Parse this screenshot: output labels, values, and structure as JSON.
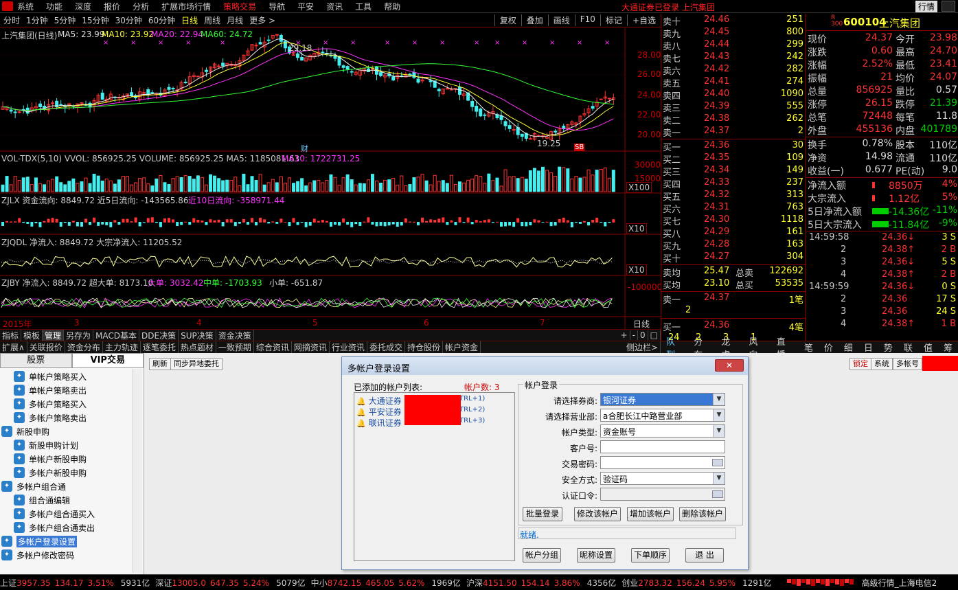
{
  "menu": {
    "items": [
      "系统",
      "功能",
      "深度",
      "报价",
      "分析",
      "扩展市场行情",
      "策略交易",
      "导航",
      "平安",
      "资讯",
      "工具",
      "帮助"
    ],
    "status": "大通证券已登录  上汽集团",
    "quote_btn": "行情"
  },
  "period": {
    "items": [
      "分时",
      "1分钟",
      "5分钟",
      "15分钟",
      "30分钟",
      "60分钟",
      "日线",
      "周线",
      "月线",
      "更多 >"
    ],
    "active": "日线",
    "tools": [
      "复权",
      "叠加",
      "画线",
      "F10",
      "标记",
      "+自选"
    ]
  },
  "chart": {
    "title": "上汽集团(日线)",
    "ma_labels": {
      "ma5": "MA5: 23.99",
      "ma10": "MA10: 23.92",
      "ma20": "MA20: 22.94",
      "ma60": "MA60: 24.72"
    },
    "price_ticks": [
      "28.00",
      "26.00",
      "24.00",
      "22.00",
      "20.00"
    ],
    "high_label": "29.18",
    "low_label": "19.25",
    "vol_label": "VOL-TDX(5,10)  VVOL: 856925.25  VOLUME: 856925.25  MA5: 1185081.63",
    "vol_ma10": "MA10: 1722731.25",
    "vol_ticks": [
      "30000",
      "15000",
      "X100"
    ],
    "zjlx_label": "ZJLX  资金流向: 8849.72   近5日流向: -143565.86",
    "zjlx_10": "近10日流向: -358971.44",
    "zjqdl_label": "ZJQDL  净流入: 8849.72  大宗净流入: 11205.52",
    "zjby_label": "ZJBY  净流入: 8849.72  超大单: 8173.10",
    "zjby_big": "大单: 3032.42",
    "zjby_mid": "中单: -1703.93",
    "zjby_small": "小单: -651.87",
    "x10": "X10",
    "zjby_tick": "-100000",
    "xaxis": [
      "2015年",
      "3",
      "4",
      "5",
      "6",
      "7"
    ],
    "xaxis_right": "日线",
    "cai": "财",
    "sb": "SB"
  },
  "tabs1": [
    "指标",
    "模板",
    "管理",
    "另存为",
    "MACD基本",
    "DDE决策",
    "SUP决策",
    "资金决策"
  ],
  "tabs1_active": "管理",
  "tabs1_right": [
    "+",
    "-",
    "0",
    "□"
  ],
  "tabs2": [
    "扩展∧",
    "关联报价",
    "资金分布",
    "主力轨迹",
    "逐笔委托",
    "热点题材",
    "一致预期",
    "综合资讯",
    "网摘资讯",
    "行业资讯",
    "委托成交",
    "持仓股份",
    "帐户资金"
  ],
  "tabs2_right": "侧边栏>",
  "orderbook": {
    "sells": [
      {
        "l": "卖十",
        "p": "24.46",
        "v": "251"
      },
      {
        "l": "卖九",
        "p": "24.45",
        "v": "800"
      },
      {
        "l": "卖八",
        "p": "24.44",
        "v": "299"
      },
      {
        "l": "卖七",
        "p": "24.43",
        "v": "242"
      },
      {
        "l": "卖六",
        "p": "24.42",
        "v": "282"
      },
      {
        "l": "卖五",
        "p": "24.41",
        "v": "274"
      },
      {
        "l": "卖四",
        "p": "24.40",
        "v": "1090"
      },
      {
        "l": "卖三",
        "p": "24.39",
        "v": "555"
      },
      {
        "l": "卖二",
        "p": "24.38",
        "v": "262"
      },
      {
        "l": "卖一",
        "p": "24.37",
        "v": "2"
      }
    ],
    "buys": [
      {
        "l": "买一",
        "p": "24.36",
        "v": "30"
      },
      {
        "l": "买二",
        "p": "24.35",
        "v": "109"
      },
      {
        "l": "买三",
        "p": "24.34",
        "v": "149"
      },
      {
        "l": "买四",
        "p": "24.33",
        "v": "237"
      },
      {
        "l": "买五",
        "p": "24.32",
        "v": "313"
      },
      {
        "l": "买六",
        "p": "24.31",
        "v": "763"
      },
      {
        "l": "买七",
        "p": "24.30",
        "v": "1118"
      },
      {
        "l": "买八",
        "p": "24.29",
        "v": "161"
      },
      {
        "l": "买九",
        "p": "24.28",
        "v": "163"
      },
      {
        "l": "买十",
        "p": "24.27",
        "v": "304"
      }
    ],
    "avg_sell": {
      "l": "卖均",
      "p": "25.47",
      "k": "总卖",
      "v": "122692"
    },
    "avg_buy": {
      "l": "买均",
      "p": "23.10",
      "k": "总买",
      "v": "53535"
    },
    "q_sell": {
      "l": "卖一",
      "p": "24.37",
      "v": "1笔"
    },
    "q_sell_n": "2",
    "q_buy": {
      "l": "买一",
      "p": "24.36",
      "v": "4笔"
    },
    "q_buy_n": [
      "24",
      "2",
      "3",
      "1"
    ]
  },
  "quote": {
    "code": "600104",
    "name": "上汽集团",
    "badge": "R 300",
    "rows": [
      {
        "k1": "现价",
        "v1": "24.37",
        "k2": "今开",
        "v2": "23.98"
      },
      {
        "k1": "涨跌",
        "v1": "0.60",
        "k2": "最高",
        "v2": "24.70"
      },
      {
        "k1": "涨幅",
        "v1": "2.52%",
        "k2": "最低",
        "v2": "23.41"
      },
      {
        "k1": "振幅",
        "v1": "21",
        "k2": "均价",
        "v2": "24.07"
      },
      {
        "k1": "总量",
        "v1": "856925",
        "k2": "量比",
        "v2": "0.57"
      },
      {
        "k1": "涨停",
        "v1": "26.15",
        "k2": "跌停",
        "v2": "21.39"
      },
      {
        "k1": "总笔",
        "v1": "72448",
        "k2": "每笔",
        "v2": "11.8"
      },
      {
        "k1": "外盘",
        "v1": "455136",
        "k2": "内盘",
        "v2": "401789"
      },
      {
        "k1": "换手",
        "v1": "0.78%",
        "k2": "股本",
        "v2": "110亿"
      },
      {
        "k1": "净资",
        "v1": "14.98",
        "k2": "流通",
        "v2": "110亿"
      },
      {
        "k1": "收益(一)",
        "v1": "0.677",
        "k2": "PE(动)",
        "v2": "9.0"
      }
    ],
    "flow": [
      {
        "k": "净流入额",
        "v": "8850万",
        "p": "4%"
      },
      {
        "k": "大宗流入",
        "v": "1.12亿",
        "p": "5%"
      },
      {
        "k": "5日净流入额",
        "v": "-14.36亿",
        "p": "-11%"
      },
      {
        "k": "5日大宗流入",
        "v": "-11.84亿",
        "p": "-9%"
      }
    ],
    "ticks": [
      {
        "t": "14:59:58",
        "p": "24.36↓",
        "v": "3 S",
        "g": false
      },
      {
        "t": "2",
        "p": "24.38↑",
        "v": "2 B",
        "g": false
      },
      {
        "t": "3",
        "p": "24.36↓",
        "v": "5 S",
        "g": false
      },
      {
        "t": "4",
        "p": "24.38↑",
        "v": "2 B",
        "g": false
      },
      {
        "t": "14:59:59",
        "p": "24.36↓",
        "v": "0 S",
        "g": false
      },
      {
        "t": "2",
        "p": "24.36",
        "v": "17 S",
        "g": false
      },
      {
        "t": "3",
        "p": "24.36",
        "v": "24 S",
        "g": false
      },
      {
        "t": "4",
        "p": "24.38↑",
        "v": "1 B",
        "g": false
      }
    ]
  },
  "righttabs": [
    "队列",
    "分布",
    "龙虎",
    "风向",
    "直播",
    "笔",
    "价",
    "细",
    "日",
    "势",
    "联",
    "值",
    "筹"
  ],
  "righttabs_active": "队列",
  "left": {
    "tabs": [
      "股票",
      "VIP交易"
    ],
    "items": [
      {
        "label": "单帐户策略买入",
        "lvl": 2
      },
      {
        "label": "单帐户策略卖出",
        "lvl": 2
      },
      {
        "label": "多帐户策略买入",
        "lvl": 2
      },
      {
        "label": "多帐户策略卖出",
        "lvl": 2
      },
      {
        "label": "新股申购",
        "lvl": 1
      },
      {
        "label": "新股申购计划",
        "lvl": 2
      },
      {
        "label": "单帐户新股申购",
        "lvl": 2
      },
      {
        "label": "多帐户新股申购",
        "lvl": 2
      },
      {
        "label": "多帐户组合通",
        "lvl": 1
      },
      {
        "label": "组合通编辑",
        "lvl": 2
      },
      {
        "label": "多帐户组合通买入",
        "lvl": 2
      },
      {
        "label": "多帐户组合通卖出",
        "lvl": 2
      },
      {
        "label": "多帐户登录设置",
        "lvl": 1,
        "sel": true
      },
      {
        "label": "多帐户修改密码",
        "lvl": 1
      }
    ]
  },
  "lowertools": {
    "refresh": "刷新",
    "sync": "同步异地委托",
    "lock": "锁定",
    "sys": "系统",
    "multi": "多帐号"
  },
  "dialog": {
    "title": "多帐户登录设置",
    "close": "✕",
    "list_title": "已添加的帐户列表:",
    "count_label": "帐户数: 3",
    "accounts": [
      {
        "name": "大通证券",
        "key": "TRL+1)"
      },
      {
        "name": "平安证券",
        "key": "TRL+2)"
      },
      {
        "name": "联讯证券",
        "key": "TRL+3)"
      }
    ],
    "group_title": "帐户登录",
    "broker_label": "请选择券商:",
    "broker_value": "银河证券",
    "branch_label": "请选择营业部:",
    "branch_value": "a合肥长江中路营业部",
    "type_label": "帐户类型:",
    "type_value": "资金账号",
    "cust_label": "客户号:",
    "pwd_label": "交易密码:",
    "sec_label": "安全方式:",
    "sec_value": "验证码",
    "auth_label": "认证口令:",
    "btn_batch": "批量登录",
    "btn_modify": "修改该帐户",
    "btn_add": "增加该帐户",
    "btn_delete": "删除该帐户",
    "status": "就绪.",
    "btn_group": "帐户分组",
    "btn_nick": "昵称设置",
    "btn_order": "下单顺序",
    "btn_exit": "退 出"
  },
  "statusbar": [
    {
      "k": "上证",
      "v": "3957.35",
      "c": "134.17",
      "p": "3.51%",
      "amt": "5931亿"
    },
    {
      "k": "深证",
      "v": "13005.0",
      "c": "647.35",
      "p": "5.24%",
      "amt": "5079亿"
    },
    {
      "k": "中小",
      "v": "8742.15",
      "c": "465.05",
      "p": "5.62%",
      "amt": "1969亿"
    },
    {
      "k": "沪深",
      "v": "4151.50",
      "c": "154.14",
      "p": "3.86%",
      "amt": "4356亿"
    },
    {
      "k": "创业",
      "v": "2783.32",
      "c": "156.24",
      "p": "5.95%",
      "amt": "1291亿"
    }
  ],
  "status_right": "高级行情_上海电信2",
  "colors": {
    "up": "#ff3333",
    "down": "#00cc00",
    "bg": "#000000",
    "accent": "#3a78d6"
  }
}
